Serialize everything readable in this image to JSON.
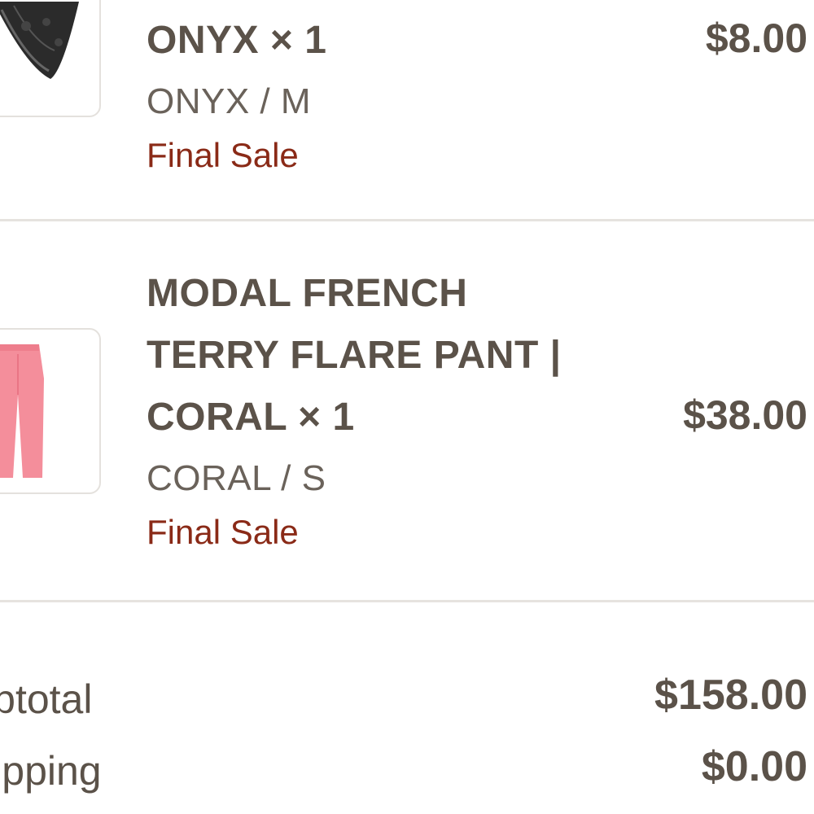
{
  "items": [
    {
      "title_lines": [
        "ONYX × 1"
      ],
      "variant": "ONYX / M",
      "sale": "Final Sale",
      "price": "$8.00",
      "image_icon": "lace-underwear-icon"
    },
    {
      "title_lines": [
        "MODAL FRENCH",
        "TERRY FLARE PANT |",
        "CORAL × 1"
      ],
      "variant": "CORAL / S",
      "sale": "Final Sale",
      "price": "$38.00",
      "image_icon": "coral-pants-icon"
    }
  ],
  "summary": {
    "subtotal_label": "Subtotal",
    "subtotal_value": "$158.00",
    "shipping_label": "Shipping",
    "shipping_value": "$0.00"
  },
  "colors": {
    "text": "#5b5249",
    "sale": "#8a2a17",
    "divider": "#e6e3df",
    "pants": "#f48e9b"
  }
}
